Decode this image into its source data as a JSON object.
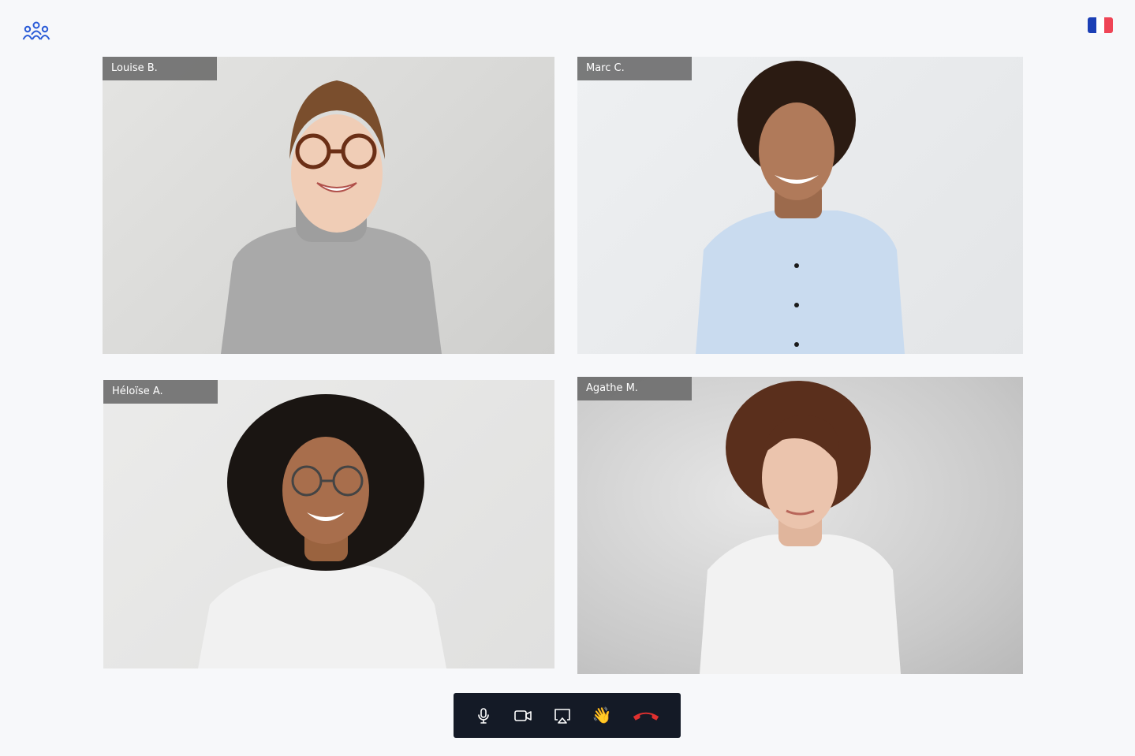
{
  "header": {
    "logo_icon": "people-group-icon",
    "language_flag_icon": "france-flag-icon",
    "flag_colors": [
      "#1b3fb5",
      "#ffffff",
      "#ef4455"
    ]
  },
  "participants": [
    {
      "name": "Louise B.",
      "hair": "#7a4e2d",
      "top": "#a9a9a9",
      "skin": "#f0cdb6"
    },
    {
      "name": "Marc C.",
      "hair": "#2b1b12",
      "top": "#c9dbef",
      "skin": "#b07a5a"
    },
    {
      "name": "Héloïse A.",
      "hair": "#1a1512",
      "top": "#f1f1f1",
      "skin": "#a86e4c"
    },
    {
      "name": "Agathe M.",
      "hair": "#5a2f1c",
      "top": "#f2f2f2",
      "skin": "#ebc4ad"
    }
  ],
  "controls": {
    "items": [
      {
        "name": "microphone-button",
        "icon": "microphone-icon"
      },
      {
        "name": "camera-button",
        "icon": "video-camera-icon"
      },
      {
        "name": "screen-share-button",
        "icon": "screen-share-icon"
      },
      {
        "name": "raise-hand-button",
        "icon": "waving-hand-icon"
      },
      {
        "name": "hang-up-button",
        "icon": "hang-up-phone-icon"
      }
    ],
    "wave_glyph": "👋",
    "hangup_color": "#e0302f",
    "bar_color": "#141a26"
  }
}
